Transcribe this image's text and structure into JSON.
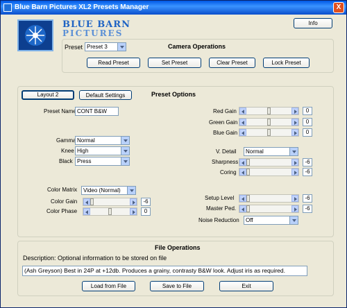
{
  "window": {
    "title": "Blue Barn Pictures XL2 Presets Manager",
    "close_glyph": "X"
  },
  "brand": {
    "line1": "BLUE BARN",
    "line2": "PICTURES"
  },
  "info_button": "Info",
  "camera": {
    "preset_label": "Preset",
    "preset_value": "Preset 3",
    "heading": "Camera Operations",
    "buttons": [
      "Read Preset",
      "Set Preset",
      "Clear Preset",
      "Lock Preset"
    ]
  },
  "preset_options": {
    "heading": "Preset Options",
    "layout_button": "Layout 2",
    "default_button": "Default Settings",
    "preset_name_label": "Preset Name",
    "preset_name_value": "CONT B&W",
    "gamma_label": "Gamma",
    "gamma_value": "Normal",
    "knee_label": "Knee",
    "knee_value": "High",
    "black_label": "Black",
    "black_value": "Press",
    "color_matrix_label": "Color Matrix",
    "color_matrix_value": "Video (Normal)",
    "color_gain_label": "Color Gain",
    "color_gain_value": "-6",
    "color_gain_level": 0.0,
    "color_phase_label": "Color Phase",
    "color_phase_value": "0",
    "color_phase_level": 0.5,
    "red_gain_label": "Red Gain",
    "red_gain_value": "0",
    "red_gain_level": 0.5,
    "green_gain_label": "Green Gain",
    "green_gain_value": "0",
    "green_gain_level": 0.5,
    "blue_gain_label": "Blue Gain",
    "blue_gain_value": "0",
    "blue_gain_level": 0.5,
    "vdetail_label": "V. Detail",
    "vdetail_value": "Normal",
    "sharpness_label": "Sharpness",
    "sharpness_value": "-6",
    "sharpness_level": 0.0,
    "coring_label": "Coring",
    "coring_value": "-6",
    "coring_level": 0.0,
    "setup_label": "Setup Level",
    "setup_value": "-6",
    "setup_level": 0.0,
    "master_label": "Master Ped.",
    "master_value": "-6",
    "master_level": 0.0,
    "noise_label": "Noise Reduction",
    "noise_value": "Off"
  },
  "file": {
    "heading": "File Operations",
    "description_label": "Description: Optional information to be stored on file",
    "description_value": "(Ash Greyson) Best in 24P at +12db. Produces a grainy, contrasty B&W look. Adjust iris as required.",
    "buttons": [
      "Load from File",
      "Save to File",
      "Exit"
    ]
  }
}
